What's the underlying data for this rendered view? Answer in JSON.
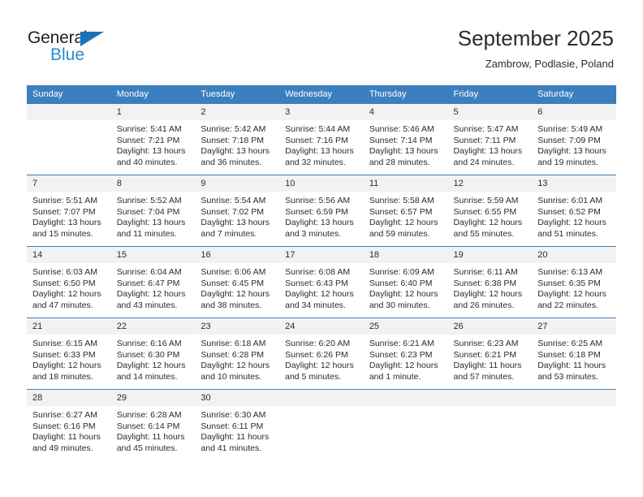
{
  "brand": {
    "name_top": "General",
    "name_bottom": "Blue",
    "accent_color": "#2b8ad0",
    "triangle_color": "#1b72b8",
    "top_text_color": "#231f20"
  },
  "header": {
    "title": "September 2025",
    "subtitle": "Zambrow, Podlasie, Poland",
    "header_bg_color": "#3c7fbf",
    "daynum_bg_color": "#f2f2f2"
  },
  "weekday_headers": [
    "Sunday",
    "Monday",
    "Tuesday",
    "Wednesday",
    "Thursday",
    "Friday",
    "Saturday"
  ],
  "calendar_data": {
    "month": "September",
    "year": 2025,
    "location": "Zambrow, Podlasie, Poland",
    "weeks": [
      [
        {
          "day": "",
          "blank": true
        },
        {
          "day": "1",
          "sunrise": "Sunrise: 5:41 AM",
          "sunset": "Sunset: 7:21 PM",
          "daylight": "Daylight: 13 hours and 40 minutes."
        },
        {
          "day": "2",
          "sunrise": "Sunrise: 5:42 AM",
          "sunset": "Sunset: 7:18 PM",
          "daylight": "Daylight: 13 hours and 36 minutes."
        },
        {
          "day": "3",
          "sunrise": "Sunrise: 5:44 AM",
          "sunset": "Sunset: 7:16 PM",
          "daylight": "Daylight: 13 hours and 32 minutes."
        },
        {
          "day": "4",
          "sunrise": "Sunrise: 5:46 AM",
          "sunset": "Sunset: 7:14 PM",
          "daylight": "Daylight: 13 hours and 28 minutes."
        },
        {
          "day": "5",
          "sunrise": "Sunrise: 5:47 AM",
          "sunset": "Sunset: 7:11 PM",
          "daylight": "Daylight: 13 hours and 24 minutes."
        },
        {
          "day": "6",
          "sunrise": "Sunrise: 5:49 AM",
          "sunset": "Sunset: 7:09 PM",
          "daylight": "Daylight: 13 hours and 19 minutes."
        }
      ],
      [
        {
          "day": "7",
          "sunrise": "Sunrise: 5:51 AM",
          "sunset": "Sunset: 7:07 PM",
          "daylight": "Daylight: 13 hours and 15 minutes."
        },
        {
          "day": "8",
          "sunrise": "Sunrise: 5:52 AM",
          "sunset": "Sunset: 7:04 PM",
          "daylight": "Daylight: 13 hours and 11 minutes."
        },
        {
          "day": "9",
          "sunrise": "Sunrise: 5:54 AM",
          "sunset": "Sunset: 7:02 PM",
          "daylight": "Daylight: 13 hours and 7 minutes."
        },
        {
          "day": "10",
          "sunrise": "Sunrise: 5:56 AM",
          "sunset": "Sunset: 6:59 PM",
          "daylight": "Daylight: 13 hours and 3 minutes."
        },
        {
          "day": "11",
          "sunrise": "Sunrise: 5:58 AM",
          "sunset": "Sunset: 6:57 PM",
          "daylight": "Daylight: 12 hours and 59 minutes."
        },
        {
          "day": "12",
          "sunrise": "Sunrise: 5:59 AM",
          "sunset": "Sunset: 6:55 PM",
          "daylight": "Daylight: 12 hours and 55 minutes."
        },
        {
          "day": "13",
          "sunrise": "Sunrise: 6:01 AM",
          "sunset": "Sunset: 6:52 PM",
          "daylight": "Daylight: 12 hours and 51 minutes."
        }
      ],
      [
        {
          "day": "14",
          "sunrise": "Sunrise: 6:03 AM",
          "sunset": "Sunset: 6:50 PM",
          "daylight": "Daylight: 12 hours and 47 minutes."
        },
        {
          "day": "15",
          "sunrise": "Sunrise: 6:04 AM",
          "sunset": "Sunset: 6:47 PM",
          "daylight": "Daylight: 12 hours and 43 minutes."
        },
        {
          "day": "16",
          "sunrise": "Sunrise: 6:06 AM",
          "sunset": "Sunset: 6:45 PM",
          "daylight": "Daylight: 12 hours and 38 minutes."
        },
        {
          "day": "17",
          "sunrise": "Sunrise: 6:08 AM",
          "sunset": "Sunset: 6:43 PM",
          "daylight": "Daylight: 12 hours and 34 minutes."
        },
        {
          "day": "18",
          "sunrise": "Sunrise: 6:09 AM",
          "sunset": "Sunset: 6:40 PM",
          "daylight": "Daylight: 12 hours and 30 minutes."
        },
        {
          "day": "19",
          "sunrise": "Sunrise: 6:11 AM",
          "sunset": "Sunset: 6:38 PM",
          "daylight": "Daylight: 12 hours and 26 minutes."
        },
        {
          "day": "20",
          "sunrise": "Sunrise: 6:13 AM",
          "sunset": "Sunset: 6:35 PM",
          "daylight": "Daylight: 12 hours and 22 minutes."
        }
      ],
      [
        {
          "day": "21",
          "sunrise": "Sunrise: 6:15 AM",
          "sunset": "Sunset: 6:33 PM",
          "daylight": "Daylight: 12 hours and 18 minutes."
        },
        {
          "day": "22",
          "sunrise": "Sunrise: 6:16 AM",
          "sunset": "Sunset: 6:30 PM",
          "daylight": "Daylight: 12 hours and 14 minutes."
        },
        {
          "day": "23",
          "sunrise": "Sunrise: 6:18 AM",
          "sunset": "Sunset: 6:28 PM",
          "daylight": "Daylight: 12 hours and 10 minutes."
        },
        {
          "day": "24",
          "sunrise": "Sunrise: 6:20 AM",
          "sunset": "Sunset: 6:26 PM",
          "daylight": "Daylight: 12 hours and 5 minutes."
        },
        {
          "day": "25",
          "sunrise": "Sunrise: 6:21 AM",
          "sunset": "Sunset: 6:23 PM",
          "daylight": "Daylight: 12 hours and 1 minute."
        },
        {
          "day": "26",
          "sunrise": "Sunrise: 6:23 AM",
          "sunset": "Sunset: 6:21 PM",
          "daylight": "Daylight: 11 hours and 57 minutes."
        },
        {
          "day": "27",
          "sunrise": "Sunrise: 6:25 AM",
          "sunset": "Sunset: 6:18 PM",
          "daylight": "Daylight: 11 hours and 53 minutes."
        }
      ],
      [
        {
          "day": "28",
          "sunrise": "Sunrise: 6:27 AM",
          "sunset": "Sunset: 6:16 PM",
          "daylight": "Daylight: 11 hours and 49 minutes."
        },
        {
          "day": "29",
          "sunrise": "Sunrise: 6:28 AM",
          "sunset": "Sunset: 6:14 PM",
          "daylight": "Daylight: 11 hours and 45 minutes."
        },
        {
          "day": "30",
          "sunrise": "Sunrise: 6:30 AM",
          "sunset": "Sunset: 6:11 PM",
          "daylight": "Daylight: 11 hours and 41 minutes."
        },
        {
          "day": "",
          "blank": true
        },
        {
          "day": "",
          "blank": true
        },
        {
          "day": "",
          "blank": true
        },
        {
          "day": "",
          "blank": true
        }
      ]
    ]
  }
}
